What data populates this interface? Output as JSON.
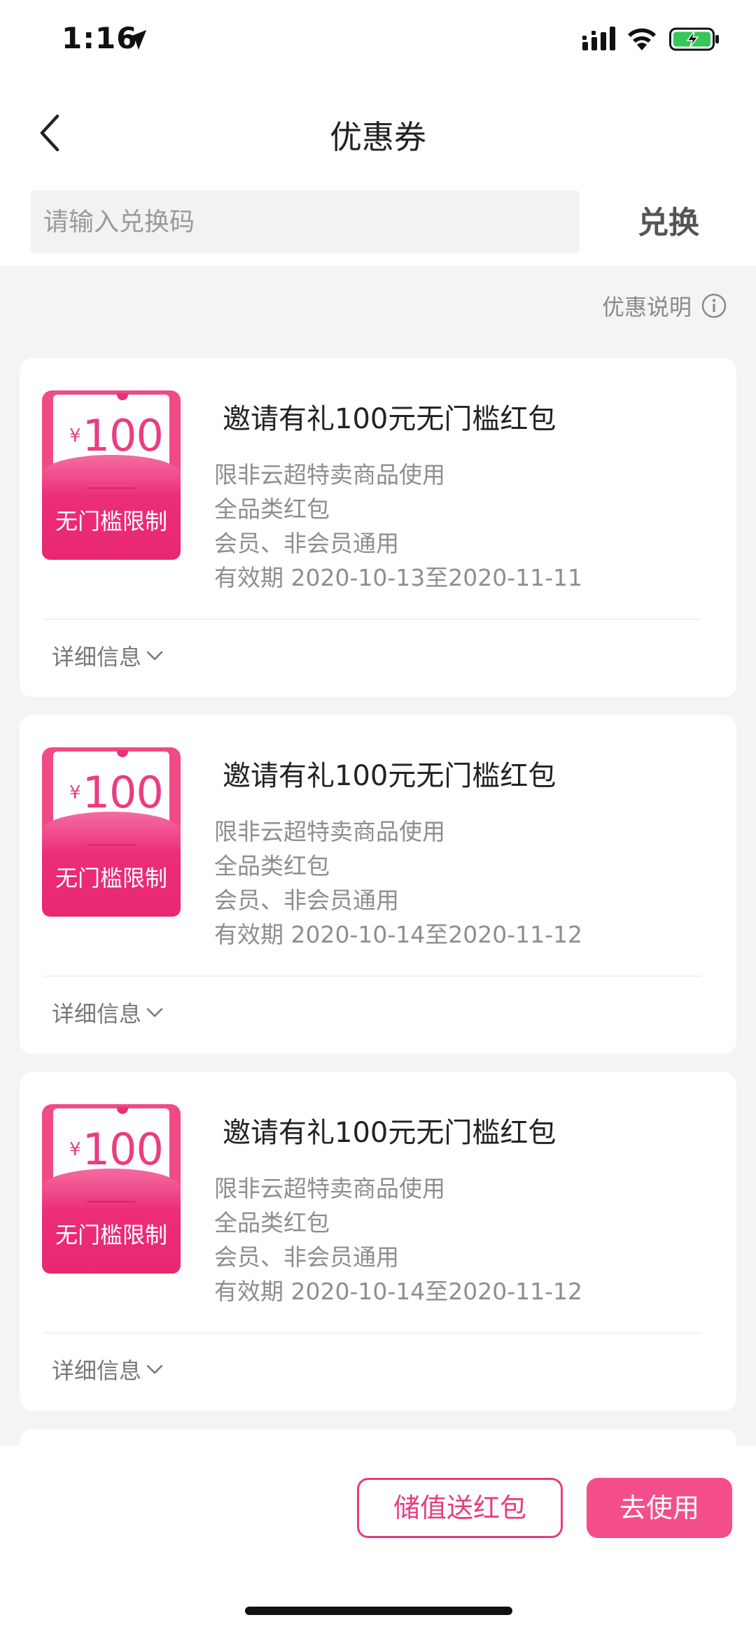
{
  "status_bar": {
    "time": "1:16"
  },
  "nav": {
    "title": "优惠券"
  },
  "redeem": {
    "placeholder": "请输入兑换码",
    "button_label": "兑换"
  },
  "promo_explain": {
    "label": "优惠说明",
    "icon": "info-icon"
  },
  "coupons": [
    {
      "envelope_currency": "¥",
      "envelope_value": "100",
      "envelope_label": "无门槛限制",
      "title": "邀请有礼100元无门槛红包",
      "lines": [
        "限非云超特卖商品使用",
        "全品类红包",
        "会员、非会员通用",
        "有效期 2020-10-13至2020-11-11"
      ],
      "detail_label": "详细信息"
    },
    {
      "envelope_currency": "¥",
      "envelope_value": "100",
      "envelope_label": "无门槛限制",
      "title": "邀请有礼100元无门槛红包",
      "lines": [
        "限非云超特卖商品使用",
        "全品类红包",
        "会员、非会员通用",
        "有效期 2020-10-14至2020-11-12"
      ],
      "detail_label": "详细信息"
    },
    {
      "envelope_currency": "¥",
      "envelope_value": "100",
      "envelope_label": "无门槛限制",
      "title": "邀请有礼100元无门槛红包",
      "lines": [
        "限非云超特卖商品使用",
        "全品类红包",
        "会员、非会员通用",
        "有效期 2020-10-14至2020-11-12"
      ],
      "detail_label": "详细信息"
    }
  ],
  "bottom_bar": {
    "recharge_label": "储值送红包",
    "use_label": "去使用"
  },
  "colors": {
    "accent": "#f44d8b",
    "envelope": "#ec2e76"
  }
}
